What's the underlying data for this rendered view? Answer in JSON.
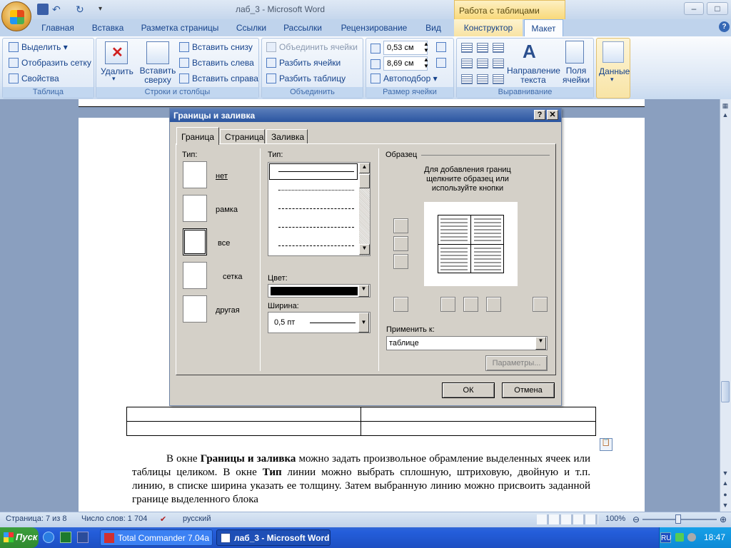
{
  "window": {
    "title": "лаб_3 - Microsoft Word",
    "context_title": "Работа с таблицами"
  },
  "tabs": [
    "Главная",
    "Вставка",
    "Разметка страницы",
    "Ссылки",
    "Рассылки",
    "Рецензирование",
    "Вид",
    "Конструктор",
    "Макет"
  ],
  "ribbon": {
    "table_group": {
      "label": "Таблица",
      "items": [
        "Выделить",
        "Отобразить сетку",
        "Свойства"
      ]
    },
    "rows_cols_group": {
      "label": "Строки и столбцы",
      "delete": "Удалить",
      "insert_above": "Вставить сверху",
      "items": [
        "Вставить снизу",
        "Вставить слева",
        "Вставить справа"
      ]
    },
    "merge_group": {
      "label": "Объединить",
      "items": [
        "Объединить ячейки",
        "Разбить ячейки",
        "Разбить таблицу"
      ]
    },
    "cell_size_group": {
      "label": "Размер ячейки",
      "height": "0,53 см",
      "width": "8,69 см",
      "autofit": "Автоподбор"
    },
    "align_group": {
      "label": "Выравнивание",
      "text_direction": "Направление текста",
      "margins": "Поля ячейки"
    },
    "data_group": {
      "label": "Данные"
    }
  },
  "dialog": {
    "title": "Границы и заливка",
    "tabs": [
      "Граница",
      "Страница",
      "Заливка"
    ],
    "type_label": "Тип:",
    "presets": [
      "нет",
      "рамка",
      "все",
      "сетка",
      "другая"
    ],
    "style_label": "Тип:",
    "color_label": "Цвет:",
    "width_label": "Ширина:",
    "width_value": "0,5 пт",
    "preview_label": "Образец",
    "preview_hint": "Для добавления границ щелкните образец или используйте кнопки",
    "apply_label": "Применить к:",
    "apply_value": "таблице",
    "options_button": "Параметры...",
    "ok": "ОК",
    "cancel": "Отмена"
  },
  "document": {
    "paragraph_parts": [
      "В окне ",
      "Границы и заливка",
      " можно задать произвольное обрамление выделенных ячеек или таблицы целиком. В окне ",
      "Тип",
      " линии можно выбрать сплошную, штриховую, двойную и т.п. линию, в списке ширина указать ее толщину. Затем выбранную линию можно присвоить заданной границе выделенного блока"
    ]
  },
  "status": {
    "page": "Страница: 7 из 8",
    "words": "Число слов: 1 704",
    "language": "русский",
    "zoom": "100%"
  },
  "taskbar": {
    "start": "Пуск",
    "tasks": [
      "Total Commander 7.04a ...",
      "лаб_3 - Microsoft Word"
    ],
    "lang": "RU",
    "time": "18:47"
  }
}
